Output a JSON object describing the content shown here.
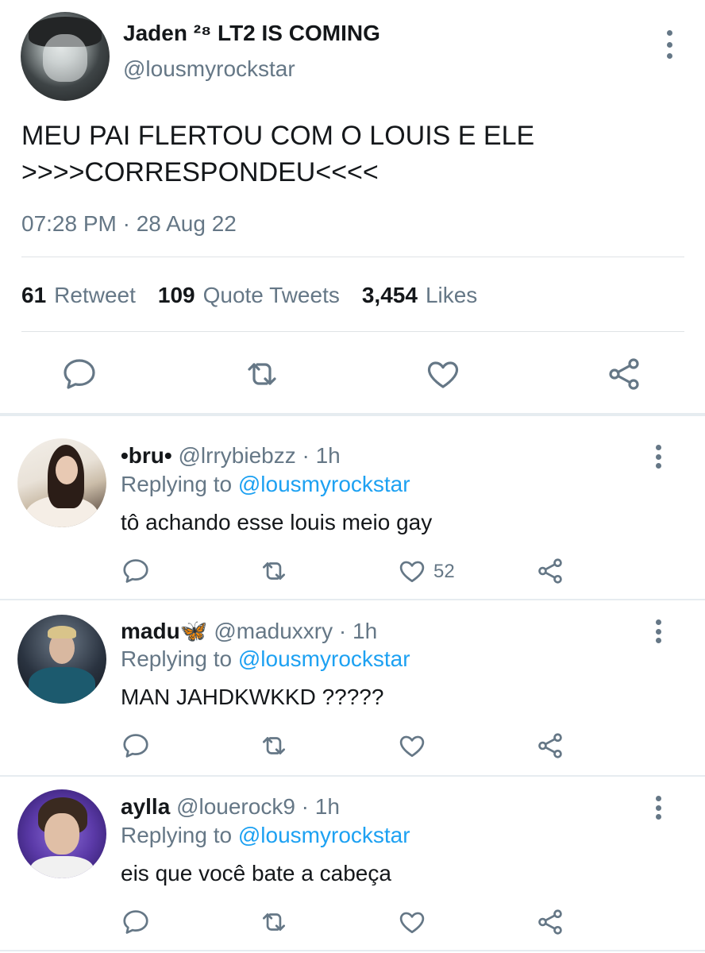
{
  "main_tweet": {
    "author": {
      "display_name": "Jaden ²⁸ LT2 IS COMING",
      "handle": "@lousmyrockstar"
    },
    "text_lines": [
      "MEU PAI FLERTOU COM O LOUIS E ELE",
      ">>>>CORRESPONDEU<<<<"
    ],
    "timestamp": "07:28 PM · 28 Aug 22",
    "stats": {
      "retweets": {
        "count": "61",
        "label": "Retweet"
      },
      "quotes": {
        "count": "109",
        "label": "Quote Tweets"
      },
      "likes": {
        "count": "3,454",
        "label": "Likes"
      }
    },
    "actions": [
      "reply-icon",
      "retweet-icon",
      "like-icon",
      "share-icon"
    ]
  },
  "replies": [
    {
      "display_name": "•bru•",
      "meta": "@lrrybiebzz · 1h",
      "replying_prefix": "Replying to ",
      "replying_to": "@lousmyrockstar",
      "text": "tô achando esse louis meio gay",
      "like_count": "52"
    },
    {
      "display_name": "madu🦋",
      "meta": "@maduxxry · 1h",
      "replying_prefix": "Replying to ",
      "replying_to": "@lousmyrockstar",
      "text": "MAN JAHDKWKKD ?????",
      "like_count": ""
    },
    {
      "display_name": "aylla",
      "meta": "@louerock9 · 1h",
      "replying_prefix": "Replying to ",
      "replying_to": "@lousmyrockstar",
      "text": "eis que você bate a cabeça",
      "like_count": ""
    }
  ],
  "colors": {
    "text": "#14171a",
    "secondary": "#657786",
    "link": "#1da1f2",
    "divider": "#dfe3e6"
  }
}
